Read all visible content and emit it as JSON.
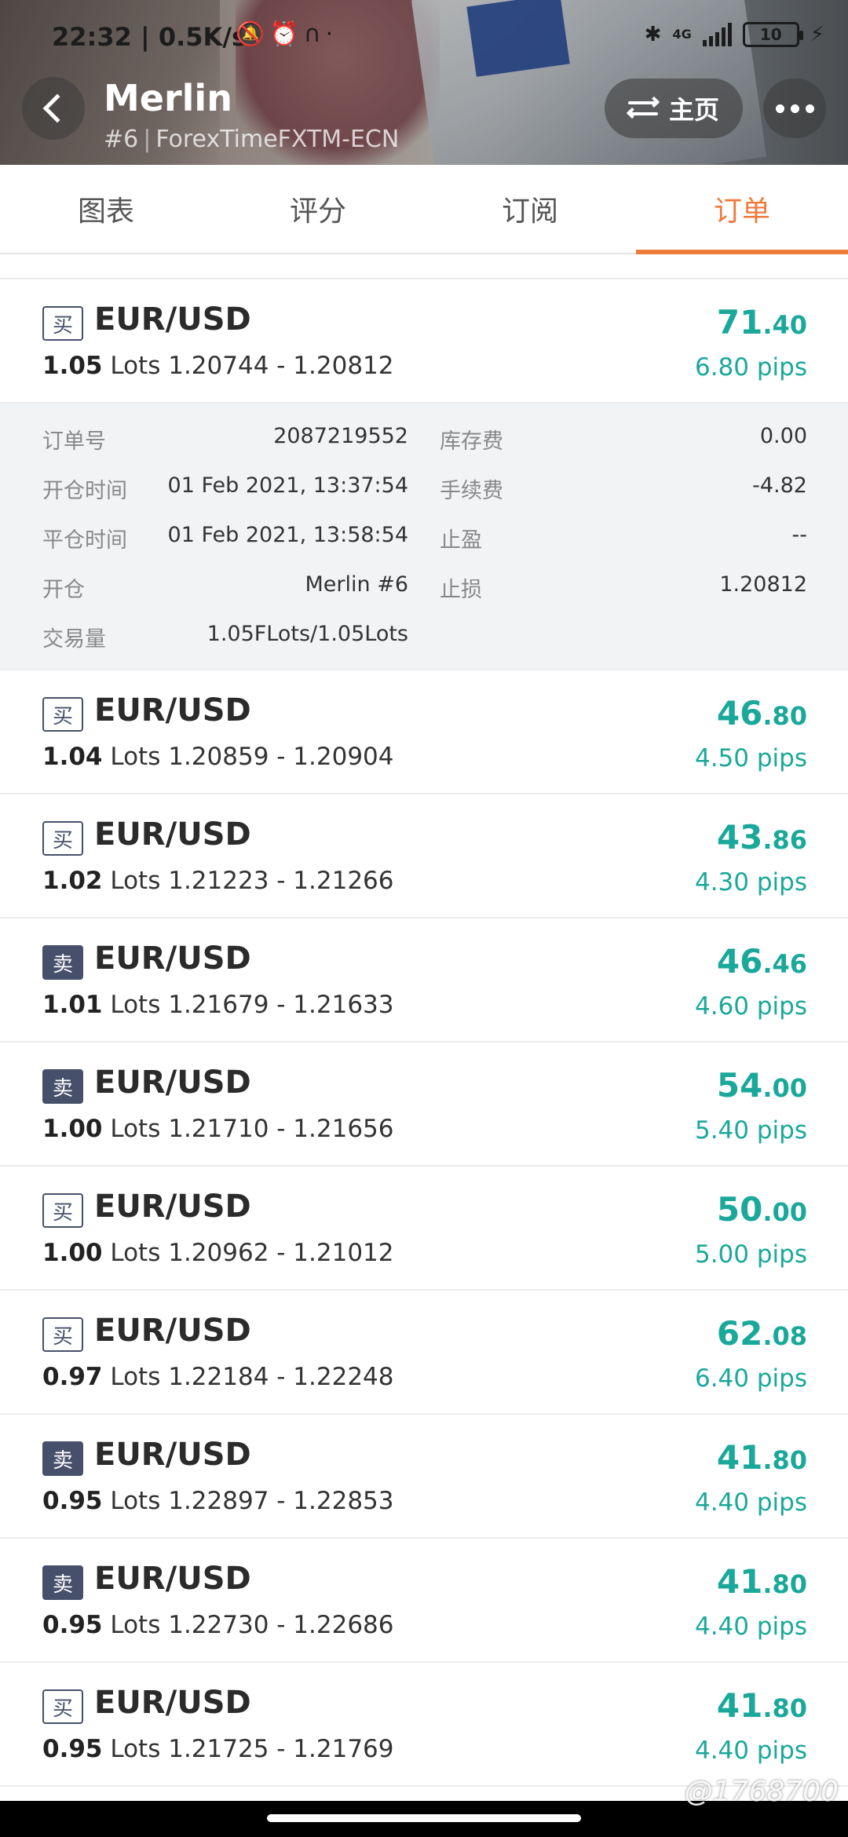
{
  "status_bar": {
    "time": "22:32 | 0.5K/s",
    "icons": "🔕⏰∩·",
    "network": "4G",
    "battery": "10"
  },
  "header": {
    "trader_name": "Merlin",
    "rank": "#6",
    "broker": "ForexTimeFXTM-ECN",
    "home_label": "主页"
  },
  "tabs": [
    {
      "label": "图表",
      "active": false
    },
    {
      "label": "评分",
      "active": false
    },
    {
      "label": "订阅",
      "active": false
    },
    {
      "label": "订单",
      "active": true
    }
  ],
  "lots_unit": "Lots",
  "pips_unit": "pips",
  "orders": [
    {
      "side": "买",
      "symbol": "EUR/USD",
      "lots": "1.05",
      "prices": "1.20744 - 1.20812",
      "profit_int": "71",
      "profit_dec": ".40",
      "pips": "6.80"
    },
    {
      "side": "买",
      "symbol": "EUR/USD",
      "lots": "1.04",
      "prices": "1.20859 - 1.20904",
      "profit_int": "46",
      "profit_dec": ".80",
      "pips": "4.50"
    },
    {
      "side": "买",
      "symbol": "EUR/USD",
      "lots": "1.02",
      "prices": "1.21223 - 1.21266",
      "profit_int": "43",
      "profit_dec": ".86",
      "pips": "4.30"
    },
    {
      "side": "卖",
      "symbol": "EUR/USD",
      "lots": "1.01",
      "prices": "1.21679 - 1.21633",
      "profit_int": "46",
      "profit_dec": ".46",
      "pips": "4.60"
    },
    {
      "side": "卖",
      "symbol": "EUR/USD",
      "lots": "1.00",
      "prices": "1.21710 - 1.21656",
      "profit_int": "54",
      "profit_dec": ".00",
      "pips": "5.40"
    },
    {
      "side": "买",
      "symbol": "EUR/USD",
      "lots": "1.00",
      "prices": "1.20962 - 1.21012",
      "profit_int": "50",
      "profit_dec": ".00",
      "pips": "5.00"
    },
    {
      "side": "买",
      "symbol": "EUR/USD",
      "lots": "0.97",
      "prices": "1.22184 - 1.22248",
      "profit_int": "62",
      "profit_dec": ".08",
      "pips": "6.40"
    },
    {
      "side": "卖",
      "symbol": "EUR/USD",
      "lots": "0.95",
      "prices": "1.22897 - 1.22853",
      "profit_int": "41",
      "profit_dec": ".80",
      "pips": "4.40"
    },
    {
      "side": "卖",
      "symbol": "EUR/USD",
      "lots": "0.95",
      "prices": "1.22730 - 1.22686",
      "profit_int": "41",
      "profit_dec": ".80",
      "pips": "4.40"
    },
    {
      "side": "买",
      "symbol": "EUR/USD",
      "lots": "0.95",
      "prices": "1.21725 - 1.21769",
      "profit_int": "41",
      "profit_dec": ".80",
      "pips": "4.40"
    }
  ],
  "details": {
    "order_no_label": "订单号",
    "order_no": "2087219552",
    "open_time_label": "开仓时间",
    "open_time": "01 Feb 2021, 13:37:54",
    "close_time_label": "平仓时间",
    "close_time": "01 Feb 2021, 13:58:54",
    "open_label": "开仓",
    "open_by": "Merlin  #6",
    "volume_label": "交易量",
    "volume": "1.05FLots/1.05Lots",
    "swap_label": "库存费",
    "swap": "0.00",
    "commission_label": "手续费",
    "commission": "-4.82",
    "tp_label": "止盈",
    "tp": "--",
    "sl_label": "止损",
    "sl": "1.20812"
  },
  "watermark": "@1768700",
  "colors": {
    "accent": "#ef7a3c",
    "profit": "#1aa89a",
    "badge": "#46506a"
  }
}
